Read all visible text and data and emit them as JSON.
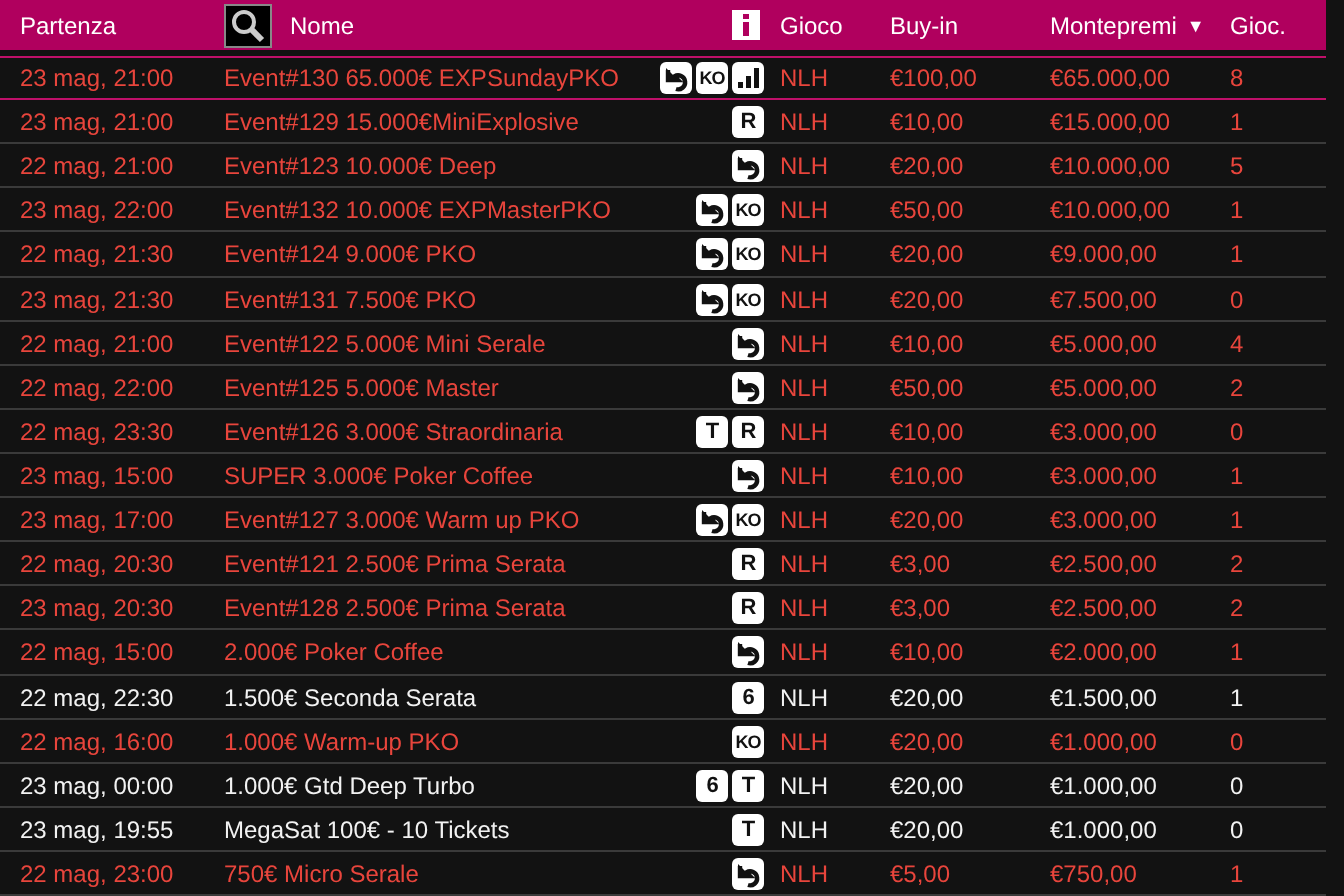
{
  "header": {
    "columns": [
      {
        "label": "Partenza",
        "kind": "start"
      },
      {
        "label": "Nome",
        "kind": "name"
      },
      {
        "label": "Gioco",
        "kind": "game"
      },
      {
        "label": "Buy-in",
        "kind": "buyin"
      },
      {
        "label": "Montepremi",
        "kind": "prize",
        "sort": "▼"
      },
      {
        "label": "Gioc.",
        "kind": "players"
      }
    ]
  },
  "rows": [
    {
      "start": "23 mag, 21:00",
      "name": "Event#130 65.000€ EXPSundayPKO",
      "badges": [
        {
          "kind": "rebuy"
        },
        {
          "kind": "text",
          "text": "KO"
        },
        {
          "kind": "chart"
        }
      ],
      "game": "NLH",
      "buyin": "€100,00",
      "prize": "€65.000,00",
      "players": "8",
      "color": "#e8453c",
      "selected": true
    },
    {
      "start": "23 mag, 21:00",
      "name": "Event#129 15.000€MiniExplosive",
      "badges": [
        {
          "kind": "text",
          "text": "R"
        }
      ],
      "game": "NLH",
      "buyin": "€10,00",
      "prize": "€15.000,00",
      "players": "1",
      "color": "#e8453c",
      "selected": false
    },
    {
      "start": "22 mag, 21:00",
      "name": "Event#123 10.000€ Deep",
      "badges": [
        {
          "kind": "rebuy"
        }
      ],
      "game": "NLH",
      "buyin": "€20,00",
      "prize": "€10.000,00",
      "players": "5",
      "color": "#e8453c",
      "selected": false
    },
    {
      "start": "23 mag, 22:00",
      "name": "Event#132 10.000€ EXPMasterPKO",
      "badges": [
        {
          "kind": "rebuy"
        },
        {
          "kind": "text",
          "text": "KO"
        }
      ],
      "game": "NLH",
      "buyin": "€50,00",
      "prize": "€10.000,00",
      "players": "1",
      "color": "#e8453c",
      "selected": false
    },
    {
      "start": "22 mag, 21:30",
      "name": "Event#124 9.000€ PKO",
      "badges": [
        {
          "kind": "rebuy"
        },
        {
          "kind": "text",
          "text": "KO"
        }
      ],
      "game": "NLH",
      "buyin": "€20,00",
      "prize": "€9.000,00",
      "players": "1",
      "color": "#e8453c",
      "selected": false
    },
    {
      "start": "23 mag, 21:30",
      "name": "Event#131 7.500€ PKO",
      "badges": [
        {
          "kind": "rebuy"
        },
        {
          "kind": "text",
          "text": "KO"
        }
      ],
      "game": "NLH",
      "buyin": "€20,00",
      "prize": "€7.500,00",
      "players": "0",
      "color": "#e8453c",
      "selected": false
    },
    {
      "start": "22 mag, 21:00",
      "name": "Event#122 5.000€ Mini Serale",
      "badges": [
        {
          "kind": "rebuy"
        }
      ],
      "game": "NLH",
      "buyin": "€10,00",
      "prize": "€5.000,00",
      "players": "4",
      "color": "#e8453c",
      "selected": false
    },
    {
      "start": "22 mag, 22:00",
      "name": "Event#125 5.000€ Master",
      "badges": [
        {
          "kind": "rebuy"
        }
      ],
      "game": "NLH",
      "buyin": "€50,00",
      "prize": "€5.000,00",
      "players": "2",
      "color": "#e8453c",
      "selected": false
    },
    {
      "start": "22 mag, 23:30",
      "name": "Event#126 3.000€ Straordinaria",
      "badges": [
        {
          "kind": "text",
          "text": "T"
        },
        {
          "kind": "text",
          "text": "R"
        }
      ],
      "game": "NLH",
      "buyin": "€10,00",
      "prize": "€3.000,00",
      "players": "0",
      "color": "#e8453c",
      "selected": false
    },
    {
      "start": "23 mag, 15:00",
      "name": "SUPER 3.000€ Poker Coffee",
      "badges": [
        {
          "kind": "rebuy"
        }
      ],
      "game": "NLH",
      "buyin": "€10,00",
      "prize": "€3.000,00",
      "players": "1",
      "color": "#e8453c",
      "selected": false
    },
    {
      "start": "23 mag, 17:00",
      "name": "Event#127 3.000€ Warm up PKO",
      "badges": [
        {
          "kind": "rebuy"
        },
        {
          "kind": "text",
          "text": "KO"
        }
      ],
      "game": "NLH",
      "buyin": "€20,00",
      "prize": "€3.000,00",
      "players": "1",
      "color": "#e8453c",
      "selected": false
    },
    {
      "start": "22 mag, 20:30",
      "name": "Event#121 2.500€ Prima Serata",
      "badges": [
        {
          "kind": "text",
          "text": "R"
        }
      ],
      "game": "NLH",
      "buyin": "€3,00",
      "prize": "€2.500,00",
      "players": "2",
      "color": "#e8453c",
      "selected": false
    },
    {
      "start": "23 mag, 20:30",
      "name": "Event#128 2.500€ Prima Serata",
      "badges": [
        {
          "kind": "text",
          "text": "R"
        }
      ],
      "game": "NLH",
      "buyin": "€3,00",
      "prize": "€2.500,00",
      "players": "2",
      "color": "#e8453c",
      "selected": false
    },
    {
      "start": "22 mag, 15:00",
      "name": "2.000€ Poker Coffee",
      "badges": [
        {
          "kind": "rebuy"
        }
      ],
      "game": "NLH",
      "buyin": "€10,00",
      "prize": "€2.000,00",
      "players": "1",
      "color": "#e8453c",
      "selected": false
    },
    {
      "start": "22 mag, 22:30",
      "name": "1.500€ Seconda Serata",
      "badges": [
        {
          "kind": "text",
          "text": "6"
        }
      ],
      "game": "NLH",
      "buyin": "€20,00",
      "prize": "€1.500,00",
      "players": "1",
      "color": "#f2f2f2",
      "selected": false
    },
    {
      "start": "22 mag, 16:00",
      "name": "1.000€ Warm-up PKO",
      "badges": [
        {
          "kind": "text",
          "text": "KO"
        }
      ],
      "game": "NLH",
      "buyin": "€20,00",
      "prize": "€1.000,00",
      "players": "0",
      "color": "#e8453c",
      "selected": false
    },
    {
      "start": "23 mag, 00:00",
      "name": "1.000€ Gtd Deep Turbo",
      "badges": [
        {
          "kind": "text",
          "text": "6"
        },
        {
          "kind": "text",
          "text": "T"
        }
      ],
      "game": "NLH",
      "buyin": "€20,00",
      "prize": "€1.000,00",
      "players": "0",
      "color": "#f2f2f2",
      "selected": false
    },
    {
      "start": "23 mag, 19:55",
      "name": "MegaSat 100€ - 10 Tickets",
      "badges": [
        {
          "kind": "text",
          "text": "T"
        }
      ],
      "game": "NLH",
      "buyin": "€20,00",
      "prize": "€1.000,00",
      "players": "0",
      "color": "#f2f2f2",
      "selected": false
    },
    {
      "start": "22 mag, 23:00",
      "name": "750€ Micro Serale",
      "badges": [
        {
          "kind": "rebuy"
        }
      ],
      "game": "NLH",
      "buyin": "€5,00",
      "prize": "€750,00",
      "players": "1",
      "color": "#e8453c",
      "selected": false
    }
  ]
}
